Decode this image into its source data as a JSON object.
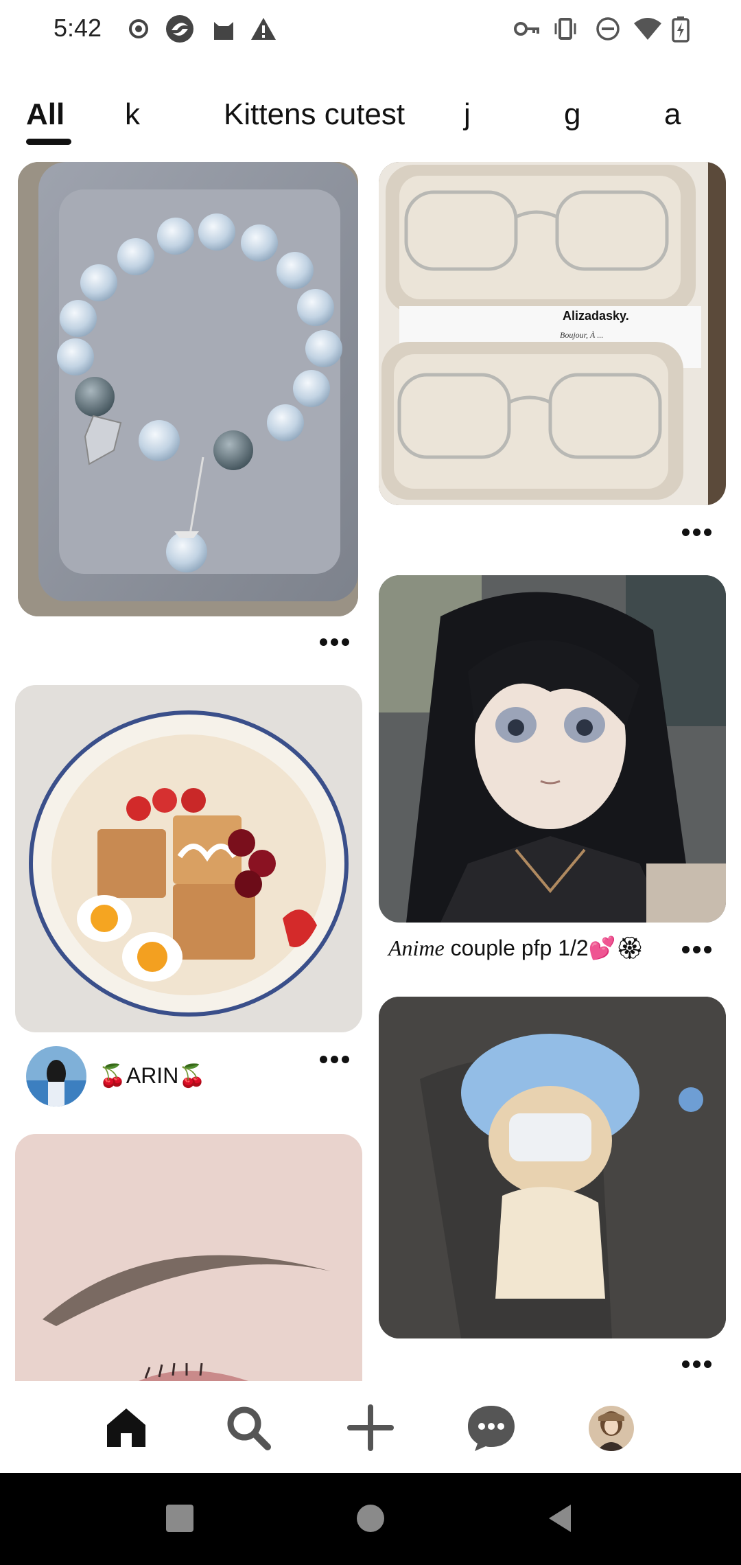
{
  "status_bar": {
    "time": "5:42",
    "left_icons": [
      "record-icon",
      "browser-icon",
      "cat-app-icon",
      "warning-icon"
    ],
    "right_icons": [
      "vpn-key-icon",
      "vibrate-icon",
      "do-not-disturb-icon",
      "wifi-icon",
      "battery-charging-icon"
    ]
  },
  "tabs": [
    {
      "label": "All",
      "active": true
    },
    {
      "label": "k",
      "active": false
    },
    {
      "label": "Kittens cutest",
      "active": false
    },
    {
      "label": "j",
      "active": false
    },
    {
      "label": "g",
      "active": false
    },
    {
      "label": "a",
      "active": false
    }
  ],
  "pins": {
    "bracelet": {
      "image": "moonstone-bracelet-photo"
    },
    "glasses": {
      "image": "glasses-in-trays-photo",
      "image_text": "Alizadasky.",
      "image_subtext": "Boujour, À ..."
    },
    "anime": {
      "image": "anime-girl-illustration",
      "caption_italic": "Anime",
      "caption_rest": " couple pfp 1/2💕🏵"
    },
    "food": {
      "image": "toast-eggs-fruit-plate-photo"
    },
    "food_author": {
      "name": "🍒ARIN🍒"
    },
    "kitten": {
      "image": "kitten-with-mask-photo"
    },
    "eyebrow": {
      "image": "eyebrow-makeup-photo"
    }
  },
  "bottom_nav": [
    {
      "name": "home",
      "icon": "home-icon",
      "active": true
    },
    {
      "name": "search",
      "icon": "search-icon",
      "active": false
    },
    {
      "name": "create",
      "icon": "plus-icon",
      "active": false
    },
    {
      "name": "messages",
      "icon": "chat-bubble-icon",
      "active": false
    },
    {
      "name": "profile",
      "icon": "profile-avatar",
      "active": false
    }
  ],
  "system_nav": [
    "recents-square-icon",
    "home-circle-icon",
    "back-triangle-icon"
  ],
  "colors": {
    "accent": "#111111",
    "background": "#ffffff"
  }
}
